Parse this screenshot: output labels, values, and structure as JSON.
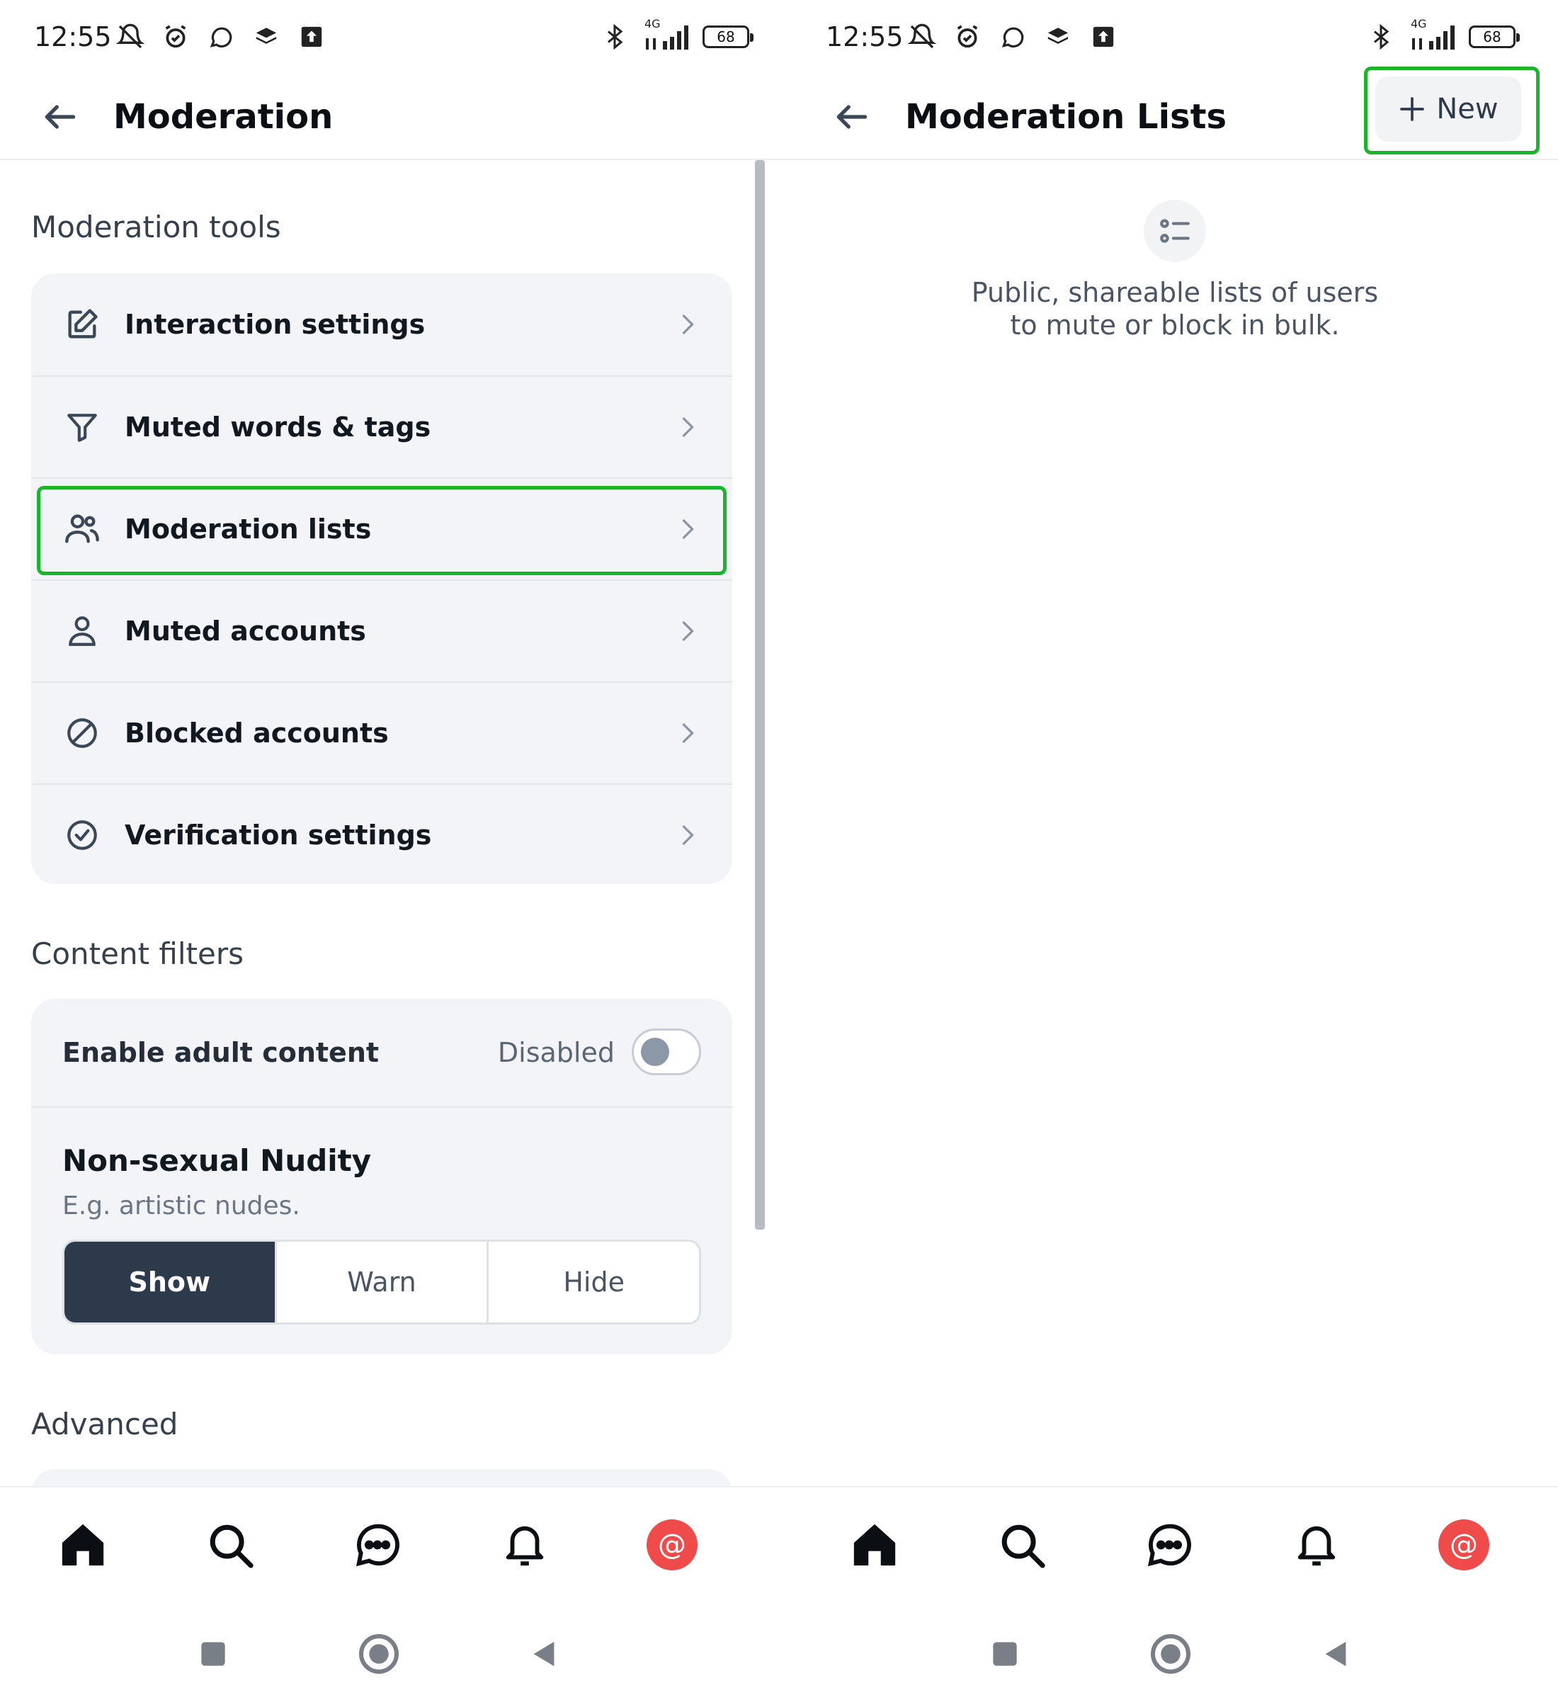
{
  "left": {
    "status": {
      "time": "12:55",
      "network": "4G",
      "battery": "68"
    },
    "header": {
      "title": "Moderation"
    },
    "moderation_tools": {
      "title": "Moderation tools",
      "items": [
        {
          "label": "Interaction settings",
          "icon": "edit-icon"
        },
        {
          "label": "Muted words & tags",
          "icon": "filter-icon"
        },
        {
          "label": "Moderation lists",
          "icon": "users-icon"
        },
        {
          "label": "Muted accounts",
          "icon": "person-icon"
        },
        {
          "label": "Blocked accounts",
          "icon": "block-icon"
        },
        {
          "label": "Verification settings",
          "icon": "check-circle-icon"
        }
      ]
    },
    "content_filters": {
      "title": "Content filters",
      "adult": {
        "label": "Enable adult content",
        "state": "Disabled"
      },
      "nudity": {
        "title": "Non-sexual Nudity",
        "description": "E.g. artistic nudes.",
        "options": [
          "Show",
          "Warn",
          "Hide"
        ],
        "selected": "Show"
      }
    },
    "advanced": {
      "title": "Advanced"
    }
  },
  "right": {
    "status": {
      "time": "12:55",
      "network": "4G",
      "battery": "68"
    },
    "header": {
      "title": "Moderation Lists"
    },
    "new_button": {
      "label": "New"
    },
    "empty_state": {
      "line1": "Public, shareable lists of users",
      "line2": "to mute or block in bulk."
    }
  },
  "colors": {
    "highlight": "#1ab52a",
    "avatar": "#ef4b4b",
    "active_segment": "#2d3a4c",
    "card_bg": "#f2f4f7"
  }
}
